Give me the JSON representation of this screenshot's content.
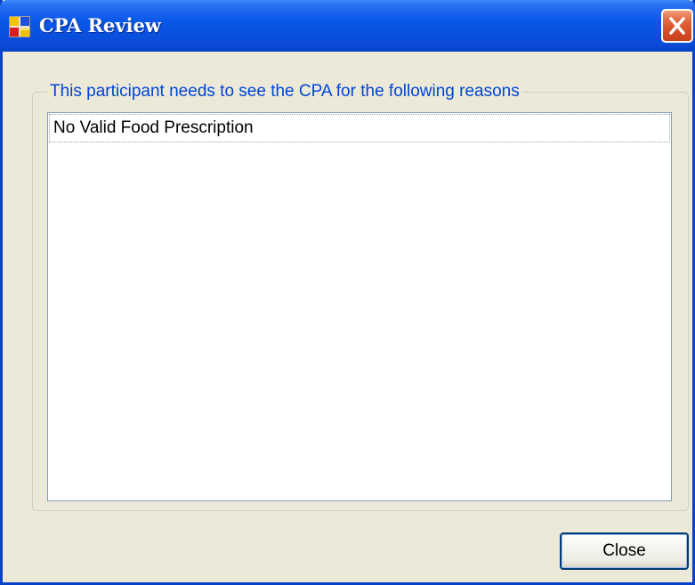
{
  "window": {
    "title": "CPA Review",
    "icon": "application-window-icon"
  },
  "titlebar": {
    "close_icon": "close-icon"
  },
  "group": {
    "legend": "This participant needs to see the CPA for the following reasons"
  },
  "reasons": {
    "items": [
      "No Valid Food Prescription"
    ]
  },
  "buttons": {
    "close_label": "Close"
  },
  "colors": {
    "titlebar": "#0A58E8",
    "window_bg": "#ECE9D8",
    "legend_text": "#0046D5",
    "close_button": "#D8522A"
  }
}
